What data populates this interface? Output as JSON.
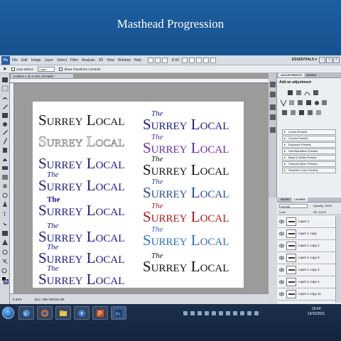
{
  "slide": {
    "title": "Masthead Progression"
  },
  "app": {
    "logo": "Ps",
    "menus": [
      "File",
      "Edit",
      "Image",
      "Layer",
      "Select",
      "Filter",
      "Analysis",
      "3D",
      "View",
      "Window",
      "Help"
    ],
    "zoom": "8.33",
    "workspace": "ESSENTIALS ▾",
    "window_controls": [
      "–",
      "□",
      "×"
    ]
  },
  "options_bar": {
    "auto_select_label": "Auto-Select:",
    "auto_select_value": "Layer",
    "transform_label": "Show Transform Controls"
  },
  "document": {
    "tab_title": "Untitled-1 @ 8.33% (RGB/8) *",
    "status_zoom": "8.33%",
    "status_doc": "Doc: 189.7M/102.4M"
  },
  "mastheads": {
    "left": [
      {
        "the": "",
        "main": "Surrey Local",
        "color": "#111111",
        "style": "plain"
      },
      {
        "the": "",
        "main": "Surrey Local",
        "color": "#ffffff",
        "style": "outline"
      },
      {
        "the": "",
        "main": "Surrey Local",
        "color": "#1a1a8c",
        "style": "plain"
      },
      {
        "the": "The",
        "main": "Surrey Local",
        "color": "#1a1a8c",
        "style": "plain"
      },
      {
        "the": "The",
        "main": "Surrey Local",
        "color": "#1a1a8c",
        "style": "plain"
      },
      {
        "the": "The",
        "main": "Surrey Local",
        "color": "#1a1a8c",
        "style": "plain"
      },
      {
        "the": "The",
        "main": "Surrey Local",
        "color": "#1a1a8c",
        "style": "plain"
      },
      {
        "the": "The",
        "main": "Surrey Local",
        "color": "#1a1a8c",
        "style": "plain"
      }
    ],
    "right": [
      {
        "the": "The",
        "main": "Surrey Local",
        "color": "#1a1a8c",
        "style": "plain"
      },
      {
        "the": "The",
        "main": "Surrey Local",
        "color": "#6a2aa8",
        "style": "plain"
      },
      {
        "the": "The",
        "main": "Surrey Local",
        "color": "#111111",
        "style": "plain"
      },
      {
        "the": "The",
        "main": "Surrey Local",
        "color": "#2a4a9a",
        "style": "plain"
      },
      {
        "the": "The",
        "main": "Surrey Local",
        "color": "#b01a1a",
        "style": "plain"
      },
      {
        "the": "The",
        "main": "Surrey Local",
        "color": "#2e6fc0",
        "style": "plain"
      },
      {
        "the": "The",
        "main": "Surrey Local",
        "color": "#111111",
        "style": "plain"
      }
    ]
  },
  "adjustments": {
    "tabs": [
      "ADJUSTMENTS",
      "MASKS"
    ],
    "title": "Add an adjustment",
    "presets": [
      "Levels Presets",
      "Curves Presets",
      "Exposure Presets",
      "Hue/Saturation Presets",
      "Black & White Presets",
      "Channel Mixer Presets",
      "Selective Color Presets"
    ]
  },
  "layers": {
    "tabs": [
      "PATHS",
      "LAYERS"
    ],
    "blend_mode": "Normal",
    "opacity": "Opacity: 100%",
    "lock": "Lock:",
    "fill": "Fill: 100%",
    "items": [
      "Layer 4",
      "Layer 1 copy",
      "Layer 1 copy 2",
      "Layer 1 copy 9",
      "Layer 1 copy 3",
      "Layer 1 copy 4",
      "Layer 1 copy 11"
    ]
  },
  "taskbar": {
    "apps": [
      "ie-icon",
      "firefox-icon",
      "explorer-icon",
      "media-player-icon",
      "powerpoint-icon",
      "photoshop-icon"
    ],
    "time": "15:04",
    "date": "13/10/2011"
  }
}
